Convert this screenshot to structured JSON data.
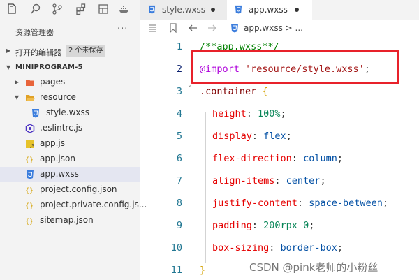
{
  "sidebar": {
    "title": "资源管理器",
    "more": "···",
    "open_editors": {
      "label": "打开的编辑器",
      "badge": "2 个未保存"
    },
    "project": {
      "label": "MINIPROGRAM-5"
    },
    "tree": [
      {
        "label": "pages",
        "icon": "folder-icon",
        "color": "#e8643a"
      },
      {
        "label": "resource",
        "icon": "folder-open-icon",
        "color": "#e0a126"
      },
      {
        "label": "style.wxss",
        "icon": "css-file-icon",
        "color": "#3b7ddd"
      },
      {
        "label": ".eslintrc.js",
        "icon": "eslint-icon",
        "color": "#4b32c3"
      },
      {
        "label": "app.js",
        "icon": "js-file-icon",
        "color": "#e6c229"
      },
      {
        "label": "app.json",
        "icon": "json-file-icon",
        "color": "#d4a100"
      },
      {
        "label": "app.wxss",
        "icon": "css-file-icon",
        "color": "#3b7ddd"
      },
      {
        "label": "project.config.json",
        "icon": "json-file-icon",
        "color": "#d4a100"
      },
      {
        "label": "project.private.config.js...",
        "icon": "json-file-icon",
        "color": "#d4a100"
      },
      {
        "label": "sitemap.json",
        "icon": "json-file-icon",
        "color": "#d4a100"
      }
    ]
  },
  "tabs": [
    {
      "label": "style.wxss",
      "active": false
    },
    {
      "label": "app.wxss",
      "active": true
    }
  ],
  "breadcrumb": {
    "file": "app.wxss",
    "sep": ">",
    "more": "..."
  },
  "editor": {
    "line_numbers": [
      "1",
      "2",
      "3",
      "4",
      "5",
      "6",
      "7",
      "8",
      "9",
      "10",
      "11"
    ],
    "lines": {
      "l1": "/**app.wxss**/",
      "l2_at": "@import",
      "l2_str": "'resource/style.wxss'",
      "l2_end": ";",
      "l3_sel": ".container",
      "l3_brace": "{",
      "props": [
        {
          "prop": "height",
          "value": "100%"
        },
        {
          "prop": "display",
          "value": "flex"
        },
        {
          "prop": "flex-direction",
          "value": "column"
        },
        {
          "prop": "align-items",
          "value": "center"
        },
        {
          "prop": "justify-content",
          "value": "space-between"
        },
        {
          "prop": "padding",
          "value": "200rpx 0"
        },
        {
          "prop": "box-sizing",
          "value": "border-box"
        }
      ],
      "l11": "}"
    }
  },
  "watermark": "CSDN @pink老师的小粉丝",
  "colors": {
    "highlight_box": "#e8212a",
    "selected_row": "#e4e6f1",
    "accent": "#3b7ddd"
  }
}
